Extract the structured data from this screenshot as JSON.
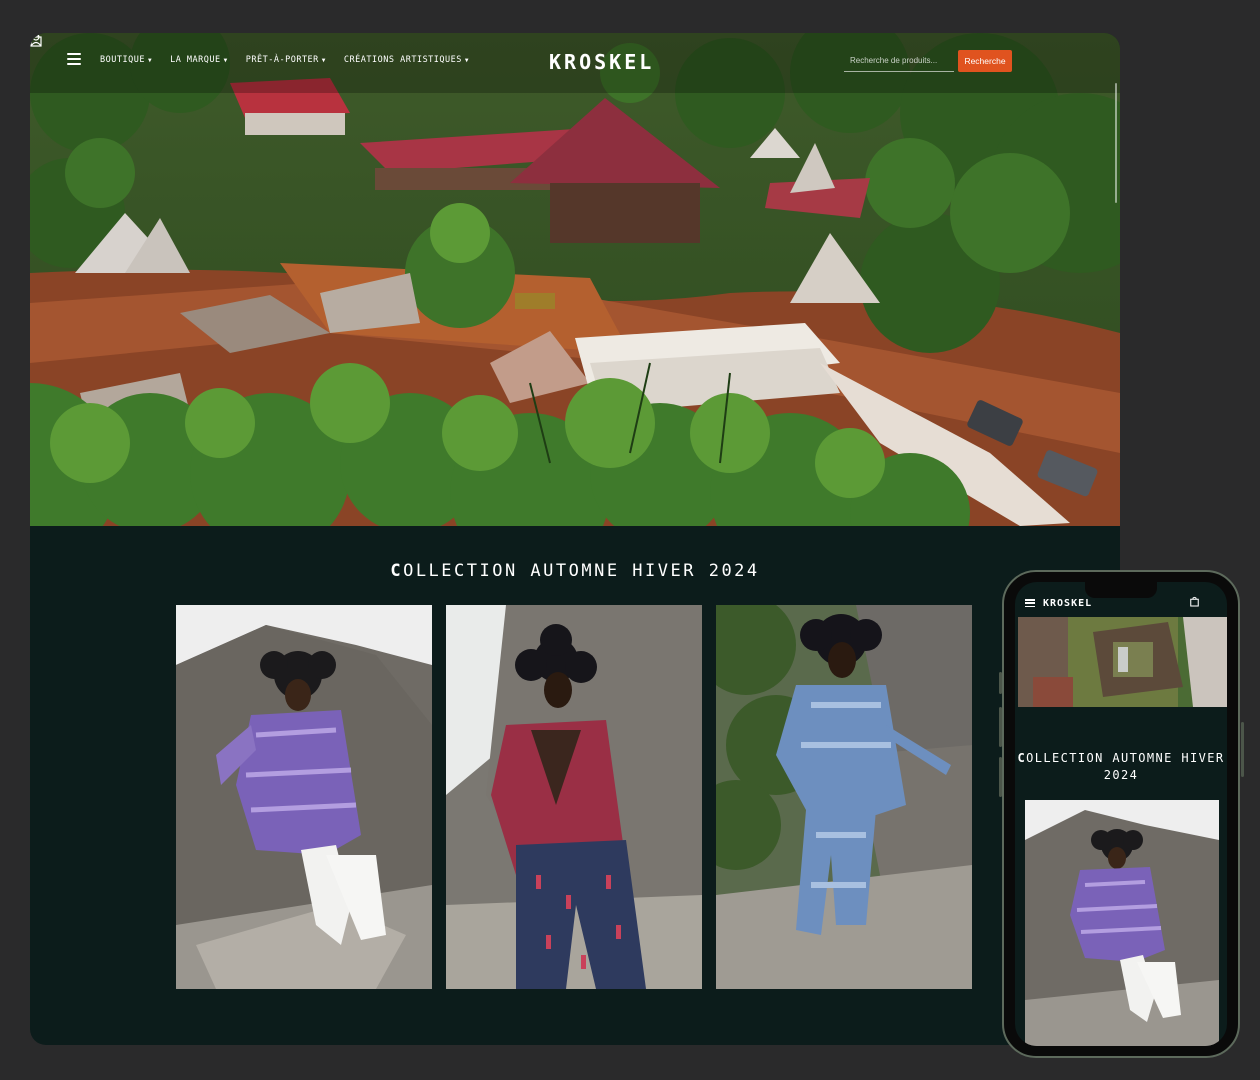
{
  "desktop": {
    "nav": {
      "menu": [
        {
          "label": "Boutique"
        },
        {
          "label": "La marque"
        },
        {
          "label": "Prêt-à-porter"
        },
        {
          "label": "Créations artistiques"
        }
      ],
      "logo": "KROSKEL",
      "search_placeholder": "Recherche de produits...",
      "search_button": "Recherche"
    },
    "section_title_first": "C",
    "section_title_rest": "OLLECTION AUTOMNE HIVER 2024",
    "products": [
      {
        "garment": "purple trench coat",
        "color": "#7a62b8"
      },
      {
        "garment": "red patterned blazer",
        "color": "#9a2f45"
      },
      {
        "garment": "blue tie-dye suit",
        "color": "#6d8fbf"
      }
    ]
  },
  "mobile": {
    "logo": "KROSKEL",
    "section_title_first": "C",
    "section_title_rest": "OLLECTION AUTOMNE HIVER 2024"
  },
  "colors": {
    "background": "#2a2a2b",
    "section_bg": "#0c1c1b",
    "accent": "#e0531f"
  }
}
